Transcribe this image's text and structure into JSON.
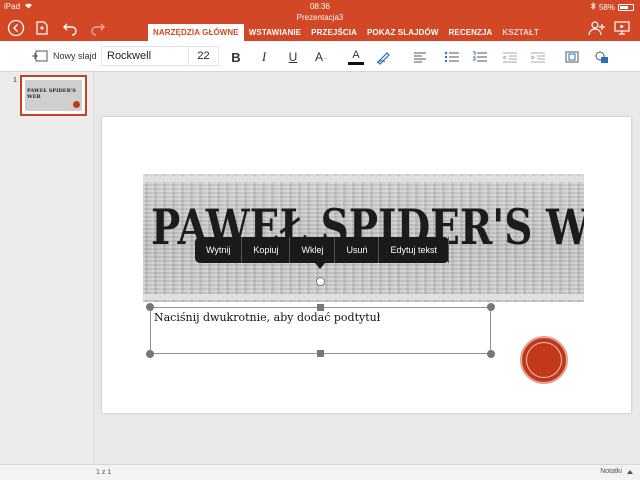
{
  "status": {
    "device": "iPad",
    "time": "08:36",
    "battery": "58%"
  },
  "doc": {
    "title": "Prezentacja3"
  },
  "tabs": [
    {
      "label": "NARZĘDZIA GŁÓWNE"
    },
    {
      "label": "WSTAWIANIE"
    },
    {
      "label": "PRZEJŚCIA"
    },
    {
      "label": "POKAZ SLAJDÓW"
    },
    {
      "label": "RECENZJA"
    },
    {
      "label": "KSZTAŁT"
    }
  ],
  "ribbon": {
    "new_slide_label": "Nowy slajd",
    "font_name": "Rockwell",
    "font_size": "22",
    "bold": "B",
    "italic": "I",
    "underline": "U",
    "strike": "A",
    "font_color": "A"
  },
  "thumbnails": [
    {
      "number": "1",
      "title": "PAWEŁ SPIDER'S WEB"
    }
  ],
  "slide": {
    "title": "PAWEŁ SPIDER'S WEB",
    "subtitle_placeholder": "Naciśnij dwukrotnie, aby dodać podtytuł"
  },
  "context_menu": {
    "items": [
      {
        "label": "Wytnij"
      },
      {
        "label": "Kopiuj"
      },
      {
        "label": "Wklej"
      },
      {
        "label": "Usuń"
      },
      {
        "label": "Edytuj tekst"
      }
    ]
  },
  "bottom": {
    "page_count": "1 z 1",
    "notes_label": "Notatki"
  },
  "colors": {
    "brand": "#d24726",
    "seal": "#c0391b"
  }
}
